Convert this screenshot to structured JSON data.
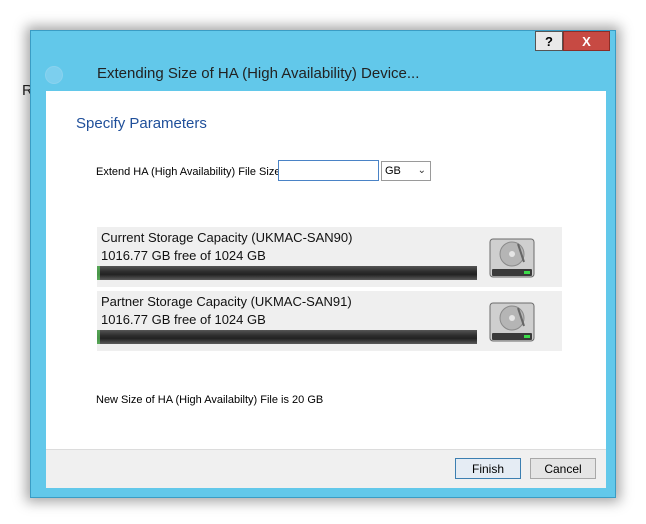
{
  "background": {
    "fragment": "R"
  },
  "window": {
    "title": "Extending Size of HA (High Availability) Device...",
    "help_label": "?",
    "close_label": "X",
    "accent_color": "#62c8ea"
  },
  "page": {
    "heading": "Specify Parameters",
    "size_label": "Extend HA (High Availability) File Size",
    "size_value": "",
    "unit_selected": "GB",
    "storages": [
      {
        "title": "Current Storage Capacity (UKMAC-SAN90)",
        "free_text": "1016.77 GB free of 1024 GB",
        "used_fraction": 0.0071,
        "icon": "hard-drive-icon"
      },
      {
        "title": "Partner Storage Capacity (UKMAC-SAN91)",
        "free_text": "1016.77 GB free of 1024 GB",
        "used_fraction": 0.0071,
        "icon": "hard-drive-icon"
      }
    ],
    "new_size_text": "New Size of HA (High Availabilty) File is 20 GB"
  },
  "footer": {
    "finish_label": "Finish",
    "cancel_label": "Cancel"
  }
}
